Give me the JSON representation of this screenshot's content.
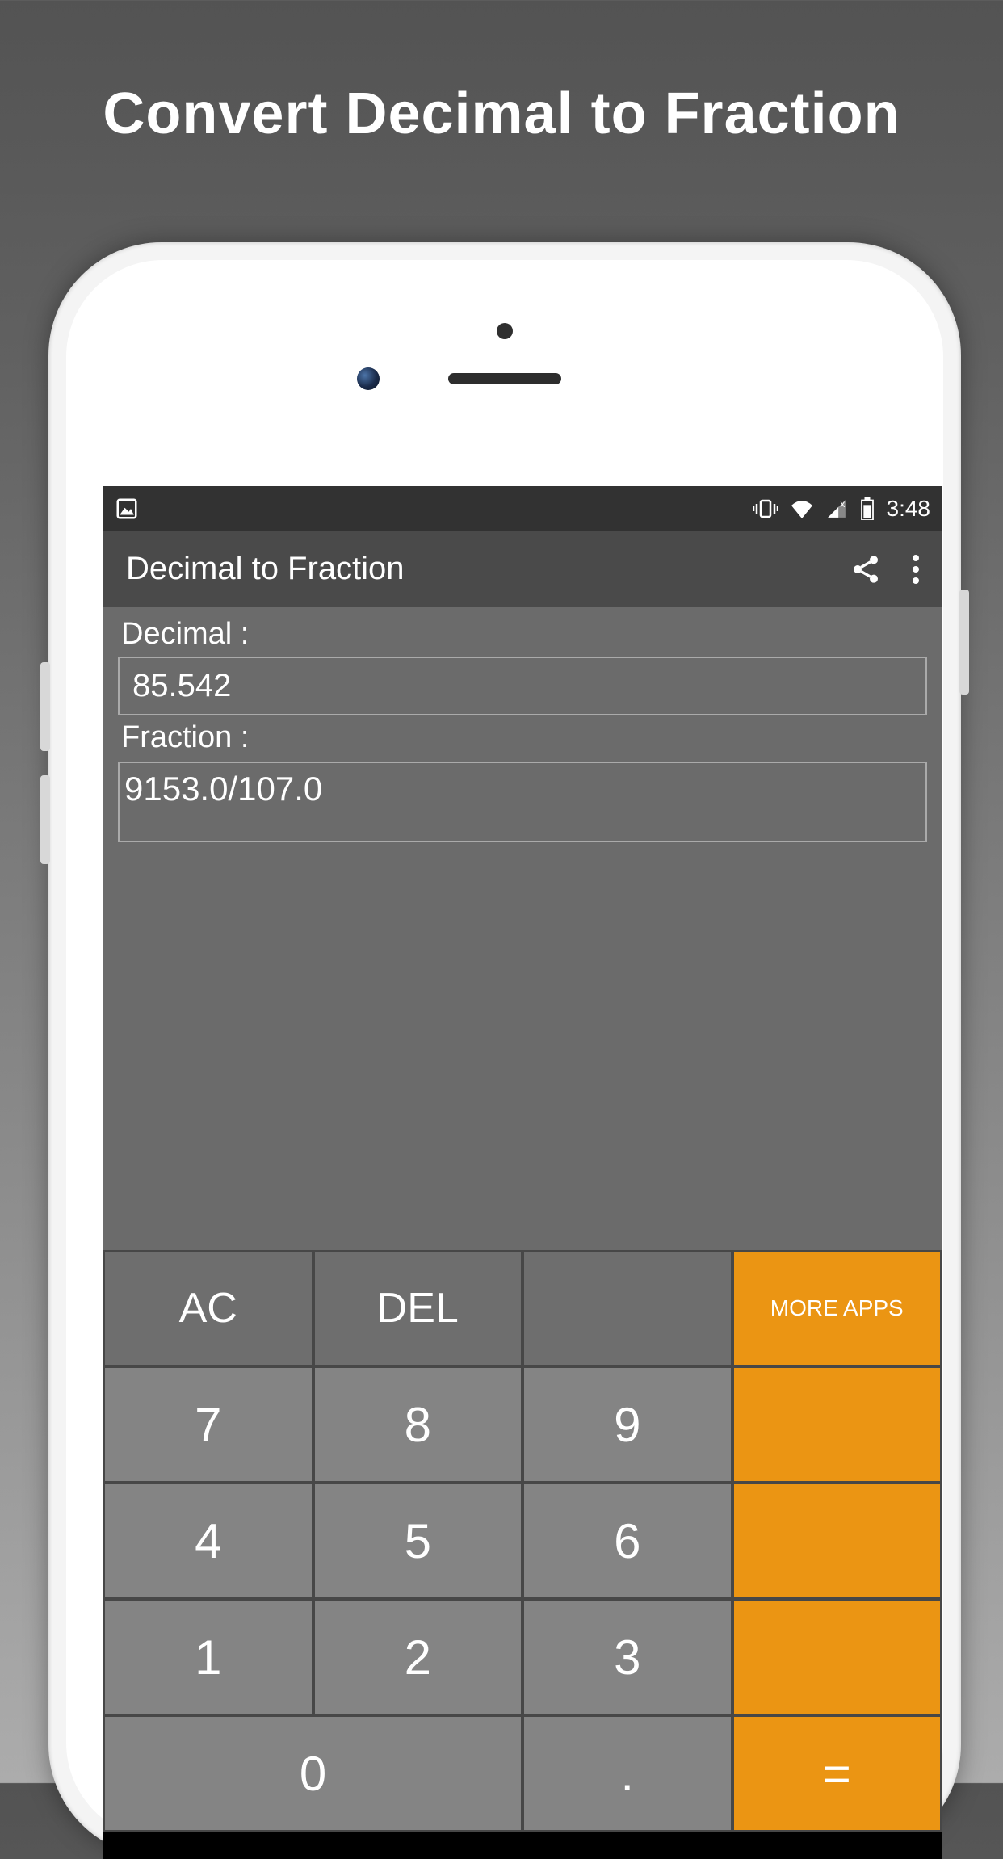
{
  "promo": {
    "title": "Convert Decimal to Fraction"
  },
  "statusbar": {
    "time": "3:48"
  },
  "appbar": {
    "title": "Decimal to Fraction"
  },
  "fields": {
    "decimal_label": "Decimal :",
    "decimal_value": "85.542",
    "fraction_label": "Fraction :",
    "fraction_value": "9153.0/107.0"
  },
  "keys": {
    "ac": "AC",
    "del": "DEL",
    "blank": "",
    "more": "MORE APPS",
    "k7": "7",
    "k8": "8",
    "k9": "9",
    "k4": "4",
    "k5": "5",
    "k6": "6",
    "k1": "1",
    "k2": "2",
    "k3": "3",
    "k0": "0",
    "dot": ".",
    "eq": "="
  }
}
